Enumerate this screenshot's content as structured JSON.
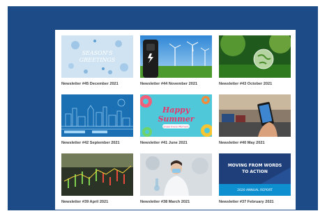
{
  "colors": {
    "frame": "#1c4b88",
    "panel": "#ffffff",
    "caption": "#3a3a3a"
  },
  "newsletters": [
    {
      "title": "Newsletter #45 December 2021",
      "image": "seasons-greetings-snowflakes",
      "image_text": "SEASON'S GREETINGS"
    },
    {
      "title": "Newsletter #44 November 2021",
      "image": "ev-charger-wind-turbines"
    },
    {
      "title": "Newsletter #43 October 2021",
      "image": "glass-globe-forest"
    },
    {
      "title": "Newsletter #42 September 2021",
      "image": "blue-city-skyline-illustration"
    },
    {
      "title": "Newsletter #41 June 2021",
      "image": "happy-summer-pool-floats",
      "image_text": "Happy Summer",
      "image_subtext": "Enjoy Every Moment"
    },
    {
      "title": "Newsletter #40 May 2021",
      "image": "smartphone-city-street"
    },
    {
      "title": "Newsletter #39 April 2021",
      "image": "stock-market-chart"
    },
    {
      "title": "Newsletter #38 March 2021",
      "image": "scientist-in-lab"
    },
    {
      "title": "Newsletter #37 February 2021",
      "image": "annual-report-cover",
      "image_text": "MOVING FROM WORDS TO ACTION",
      "image_subtext": "2020 ANNUAL REPORT"
    }
  ]
}
